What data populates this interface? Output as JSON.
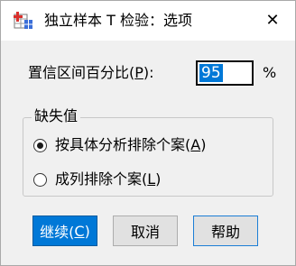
{
  "window": {
    "title": "独立样本 T 检验：选项",
    "close_glyph": "✕"
  },
  "confidence_interval": {
    "label_prefix": "置信区间百分比(",
    "label_hotkey": "P",
    "label_suffix": "):",
    "value": "95",
    "unit": "%"
  },
  "missing_values": {
    "group_title": "缺失值",
    "options": [
      {
        "prefix": "按具体分析排除个案(",
        "hotkey": "A",
        "suffix": ")",
        "selected": true
      },
      {
        "prefix": "成列排除个案(",
        "hotkey": "L",
        "suffix": ")",
        "selected": false
      }
    ]
  },
  "buttons": {
    "continue": {
      "prefix": "继续(",
      "hotkey": "C",
      "suffix": ")"
    },
    "cancel": "取消",
    "help": "帮助"
  },
  "colors": {
    "accent": "#0078d7",
    "app_icon_red": "#d9302c",
    "app_icon_blue": "#3b6fd8"
  }
}
